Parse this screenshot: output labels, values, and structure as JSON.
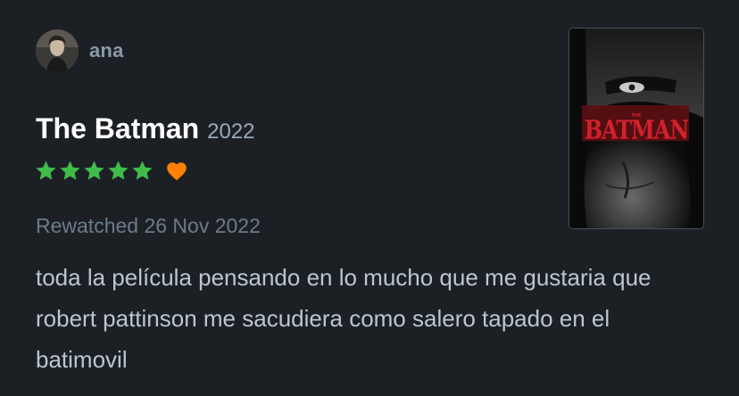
{
  "user": {
    "name": "ana",
    "avatar_icon": "user-avatar"
  },
  "film": {
    "title": "The Batman",
    "year": "2022",
    "poster_title": "BATMAN",
    "poster_small": "THE"
  },
  "rating": {
    "stars": 5,
    "max_stars": 5,
    "liked": true,
    "star_color": "#40bc4b",
    "heart_color": "#ff8000"
  },
  "watched": {
    "text": "Rewatched 26 Nov 2022"
  },
  "review": {
    "text": "toda la película pensando en lo mucho que me gustaria que robert pattinson me sacudiera como salero tapado en el batimovil"
  }
}
